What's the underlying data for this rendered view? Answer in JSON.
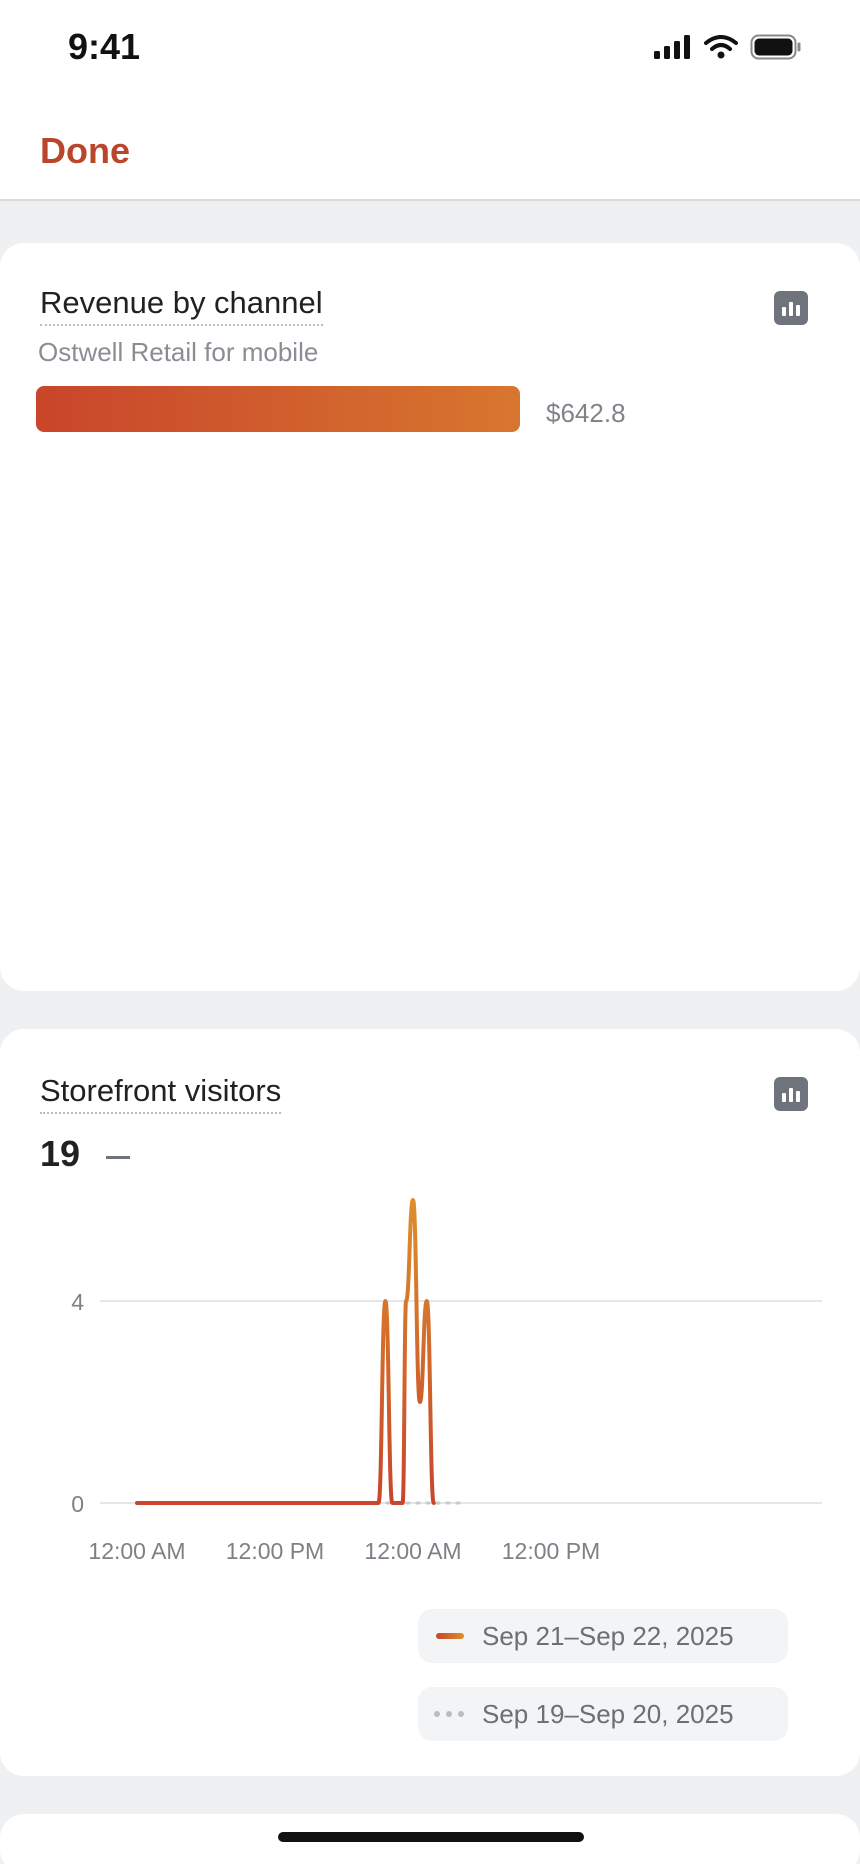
{
  "status_bar": {
    "time": "9:41"
  },
  "nav": {
    "done_label": "Done"
  },
  "revenue_card": {
    "title": "Revenue by channel",
    "channel": {
      "label": "Ostwell Retail for mobile",
      "value_text": "$642.8",
      "value": 642.8
    }
  },
  "visitors_card": {
    "title": "Storefront visitors",
    "total": "19",
    "legend": [
      {
        "label": "Sep 21–Sep 22, 2025",
        "style": "line"
      },
      {
        "label": "Sep 19–Sep 20, 2025",
        "style": "dotted"
      }
    ]
  },
  "chart_data": {
    "type": "line",
    "x_tick_labels": [
      "12:00 AM",
      "12:00 PM",
      "12:00 AM",
      "12:00 PM"
    ],
    "y_tick_labels": [
      "4",
      "0"
    ],
    "ylim": [
      0,
      4
    ],
    "x_unit": "hours since Sep 21 12:00 AM",
    "series": [
      {
        "name": "Sep 21–Sep 22, 2025",
        "color_start": "#c9452b",
        "color_end": "#dd8e2c",
        "points": [
          [
            0,
            0
          ],
          [
            35,
            0
          ],
          [
            36,
            4
          ],
          [
            37,
            0
          ],
          [
            38.5,
            0
          ],
          [
            39,
            4
          ],
          [
            40,
            6
          ],
          [
            41,
            2
          ],
          [
            42,
            4
          ],
          [
            43,
            0
          ]
        ]
      },
      {
        "name": "Sep 19–Sep 20, 2025",
        "color": "#c6c9ce",
        "points": [
          [
            0,
            0
          ],
          [
            47,
            0
          ]
        ]
      }
    ]
  },
  "colors": {
    "accent": "#b9452a",
    "bar_start": "#c9452b",
    "bar_end": "#d8762f"
  }
}
